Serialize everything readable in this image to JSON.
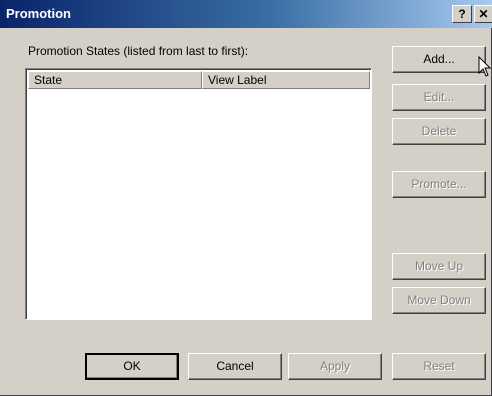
{
  "window": {
    "title": "Promotion",
    "help_label": "?",
    "close_label": "✕"
  },
  "list": {
    "label": "Promotion States (listed from last to first):",
    "columns": [
      "State",
      "View Label"
    ],
    "rows": []
  },
  "buttons": {
    "add": "Add...",
    "edit": "Edit...",
    "delete": "Delete",
    "promote": "Promote...",
    "move_up": "Move Up",
    "move_down": "Move Down",
    "ok": "OK",
    "cancel": "Cancel",
    "apply": "Apply",
    "reset": "Reset"
  }
}
